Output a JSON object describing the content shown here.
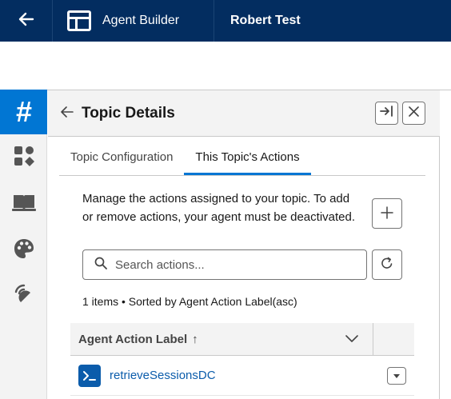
{
  "topbar": {
    "app_label": "Agent Builder",
    "record_label": "Robert Test"
  },
  "rail": {
    "items": [
      {
        "icon": "hash-icon",
        "glyph": "#"
      },
      {
        "icon": "shapes-icon"
      },
      {
        "icon": "book-icon"
      },
      {
        "icon": "palette-icon"
      },
      {
        "icon": "signal-icon"
      }
    ]
  },
  "panel": {
    "title": "Topic Details",
    "tabs": [
      {
        "label": "Topic Configuration",
        "active": false
      },
      {
        "label": "This Topic's Actions",
        "active": true
      }
    ],
    "description": "Manage the actions assigned to your topic. To add or remove actions, your agent must be deactivated.",
    "search": {
      "placeholder": "Search actions...",
      "value": ""
    },
    "summary": "1 items • Sorted by Agent Action Label(asc)",
    "table": {
      "columns": [
        {
          "label": "Agent Action Label",
          "sort": "↑"
        }
      ],
      "rows": [
        {
          "label": "retrieveSessionsDC"
        }
      ]
    }
  },
  "colors": {
    "topbar": "#032d60",
    "accent": "#0176d3",
    "link": "#0b5cab"
  }
}
